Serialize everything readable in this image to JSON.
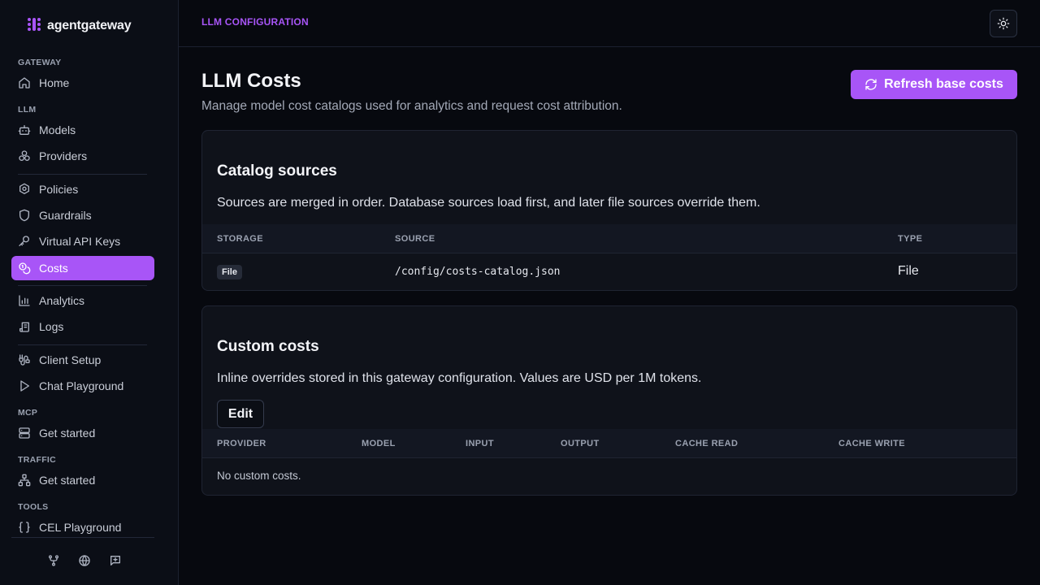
{
  "brand": {
    "name": "agentgateway",
    "logo_icon": "agentgateway-logo-icon",
    "accent": "#a855f7"
  },
  "sidebar": {
    "sections": {
      "gateway": "GATEWAY",
      "llm": "LLM",
      "mcp": "MCP",
      "traffic": "TRAFFIC",
      "tools": "TOOLS"
    },
    "items": {
      "home": {
        "label": "Home",
        "icon": "home-icon"
      },
      "models": {
        "label": "Models",
        "icon": "robot-icon"
      },
      "providers": {
        "label": "Providers",
        "icon": "providers-icon"
      },
      "policies": {
        "label": "Policies",
        "icon": "policy-icon"
      },
      "guardrails": {
        "label": "Guardrails",
        "icon": "shield-icon"
      },
      "virtual_keys": {
        "label": "Virtual API Keys",
        "icon": "key-icon"
      },
      "costs": {
        "label": "Costs",
        "icon": "coins-icon",
        "active": true
      },
      "analytics": {
        "label": "Analytics",
        "icon": "bar-chart-icon"
      },
      "logs": {
        "label": "Logs",
        "icon": "scroll-icon"
      },
      "client_setup": {
        "label": "Client Setup",
        "icon": "cable-icon"
      },
      "chat_playground": {
        "label": "Chat Playground",
        "icon": "play-icon"
      },
      "mcp_get_started": {
        "label": "Get started",
        "icon": "server-icon"
      },
      "traffic_get_started": {
        "label": "Get started",
        "icon": "network-icon"
      },
      "cel_playground": {
        "label": "CEL Playground",
        "icon": "braces-icon"
      }
    },
    "footer_icons": [
      "git-fork-icon",
      "globe-icon",
      "message-plus-icon"
    ]
  },
  "header": {
    "breadcrumb": "LLM CONFIGURATION",
    "theme_toggle_icon": "sun-icon"
  },
  "main": {
    "title": "LLM Costs",
    "subtitle": "Manage model cost catalogs used for analytics and request cost attribution.",
    "refresh_button": "Refresh base costs",
    "catalog": {
      "title": "Catalog sources",
      "description": "Sources are merged in order. Database sources load first, and later file sources override them.",
      "columns": [
        "STORAGE",
        "SOURCE",
        "TYPE"
      ],
      "rows": [
        {
          "storage": "File",
          "source": "/config/costs-catalog.json",
          "type": "File"
        }
      ]
    },
    "custom": {
      "title": "Custom costs",
      "description": "Inline overrides stored in this gateway configuration. Values are USD per 1M tokens.",
      "edit_button": "Edit",
      "columns": [
        "PROVIDER",
        "MODEL",
        "INPUT",
        "OUTPUT",
        "CACHE READ",
        "CACHE WRITE"
      ],
      "empty": "No custom costs."
    }
  }
}
